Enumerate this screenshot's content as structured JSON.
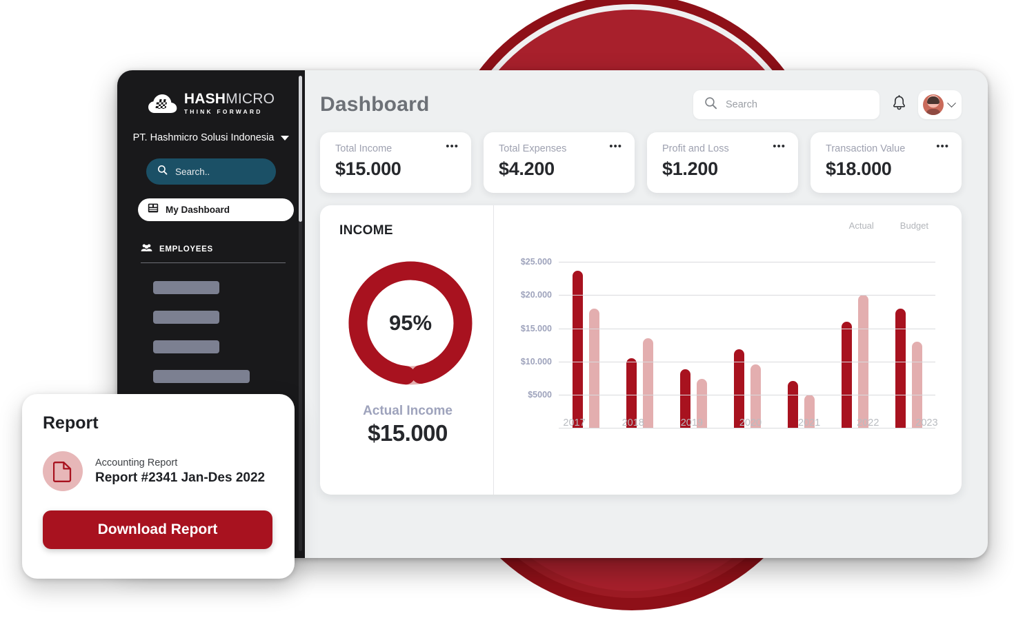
{
  "sidebar": {
    "logo": {
      "bold": "HASH",
      "light": "MICRO",
      "tagline": "THINK FORWARD",
      "icon": "hashmicro-cloud-logo-icon"
    },
    "company": "PT. Hashmicro Solusi Indonesia",
    "company_caret_icon": "chevron-down-icon",
    "search": {
      "placeholder": "Search..",
      "icon": "search-icon"
    },
    "active_item": {
      "label": "My Dashboard",
      "icon": "dashboard-icon"
    },
    "section": {
      "label": "EMPLOYEES",
      "icon": "people-icon"
    },
    "skeleton_widths": [
      96,
      96,
      96,
      140,
      140
    ]
  },
  "header": {
    "title": "Dashboard",
    "search": {
      "placeholder": "Search",
      "icon": "search-icon"
    },
    "bell_icon": "bell-icon",
    "avatar_icon": "user-avatar",
    "avatar_caret_icon": "chevron-down-icon"
  },
  "stats": [
    {
      "label": "Total Income",
      "value": "$15.000",
      "menu_icon": "ellipsis-icon"
    },
    {
      "label": "Total Expenses",
      "value": "$4.200",
      "menu_icon": "ellipsis-icon"
    },
    {
      "label": "Profit and Loss",
      "value": "$1.200",
      "menu_icon": "ellipsis-icon"
    },
    {
      "label": "Transaction Value",
      "value": "$18.000",
      "menu_icon": "ellipsis-icon"
    }
  ],
  "income": {
    "title": "INCOME",
    "percent": "95%",
    "actual_label": "Actual Income",
    "actual_value": "$15.000"
  },
  "report": {
    "title": "Report",
    "doc_icon": "document-icon",
    "subtitle": "Accounting Report",
    "name": "Report #2341 Jan-Des 2022",
    "button_label": "Download Report"
  },
  "colors": {
    "brand_red": "#a8121f",
    "brand_red_light": "#e3aeaf",
    "sidebar_bg": "#19191b",
    "sidebar_search": "#1b5066",
    "app_bg": "#eef0f1",
    "circle_outer": "#8e1018",
    "circle_inner": "#a8202c"
  },
  "chart_data": {
    "type": "bar",
    "title": "",
    "xlabel": "",
    "ylabel": "",
    "categories": [
      "2017",
      "2018",
      "2019",
      "2020",
      "2021",
      "2022",
      "2023"
    ],
    "series": [
      {
        "name": "Budget",
        "color": "#e3aeaf",
        "values": [
          18000,
          13500,
          7400,
          9600,
          5000,
          20000,
          13000
        ]
      },
      {
        "name": "Actual",
        "color": "#a8121f",
        "values": [
          23700,
          10500,
          8800,
          11800,
          7100,
          16000,
          18000
        ]
      }
    ],
    "legend": [
      "Actual",
      "Budget"
    ],
    "legend_position": "top-right",
    "ytick_labels": [
      "$25.000",
      "$20.000",
      "$15.000",
      "$10.000",
      "$5000"
    ],
    "ytick_values": [
      25000,
      20000,
      15000,
      10000,
      5000
    ],
    "ylim": [
      0,
      27000
    ],
    "grid": true
  }
}
